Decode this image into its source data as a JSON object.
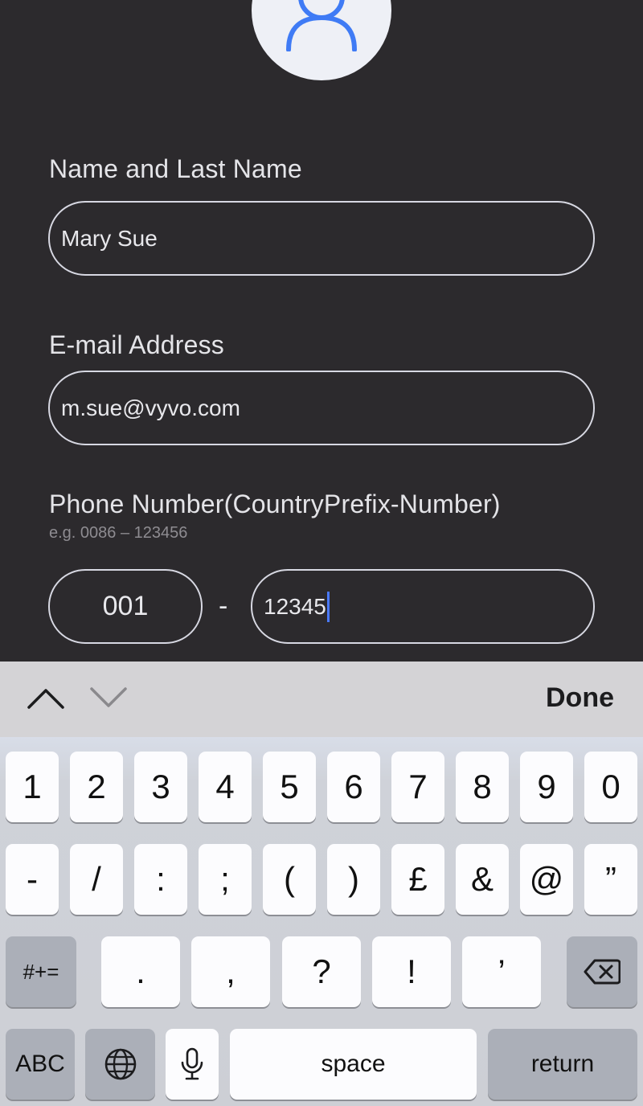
{
  "avatar": {
    "icon": "user-icon",
    "color": "#3f7bf5"
  },
  "form": {
    "name_label": "Name and Last Name",
    "name_value": "Mary Sue",
    "email_label": "E-mail Address",
    "email_value": "m.sue@vyvo.com",
    "phone_label": "Phone Number(CountryPrefix-Number)",
    "phone_hint": "e.g. 0086 – 123456",
    "phone_prefix": "001",
    "phone_separator": "-",
    "phone_number": "12345"
  },
  "accessory": {
    "prev_icon": "chevron-up-icon",
    "next_icon": "chevron-down-icon",
    "done_label": "Done"
  },
  "keyboard": {
    "row1": [
      "1",
      "2",
      "3",
      "4",
      "5",
      "6",
      "7",
      "8",
      "9",
      "0"
    ],
    "row2": [
      "-",
      "/",
      ":",
      ";",
      "(",
      ")",
      "£",
      "&",
      "@",
      "”"
    ],
    "row3": {
      "symbols_label": "#+=",
      "keys": [
        ".",
        ",",
        "?",
        "!",
        "’"
      ],
      "delete_icon": "backspace-icon"
    },
    "row4": {
      "abc_label": "ABC",
      "globe_icon": "globe-icon",
      "mic_icon": "microphone-icon",
      "space_label": "space",
      "return_label": "return"
    }
  }
}
